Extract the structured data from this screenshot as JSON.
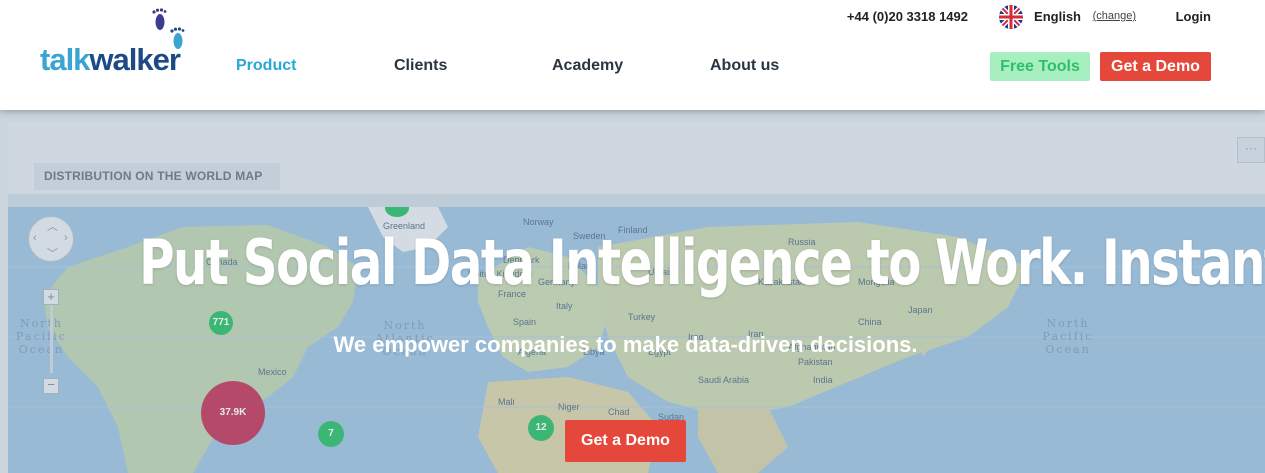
{
  "header": {
    "logo": {
      "part1": "talk",
      "part2": "walker",
      "alt": "talkwalker"
    },
    "phone": "+44 (0)20 3318 1492",
    "language": {
      "flag_icon": "uk-flag-icon",
      "current": "English",
      "change_label": "(change)"
    },
    "login_label": "Login",
    "nav": [
      {
        "label": "Product",
        "active": true
      },
      {
        "label": "Clients",
        "active": false
      },
      {
        "label": "Academy",
        "active": false
      },
      {
        "label": "About us",
        "active": false
      }
    ],
    "free_tools_label": "Free Tools",
    "get_demo_label": "Get a Demo"
  },
  "hero": {
    "headline": "Put Social Data Intelligence to Work. Instantly.",
    "subline": "We empower companies to make data-driven decisions.",
    "cta_label": "Get a Demo",
    "background": {
      "panel_title": "DISTRIBUTION ON THE WORLD MAP",
      "panel_menu": "···",
      "bubbles": [
        {
          "label": "771",
          "color": "#2fbf6a"
        },
        {
          "label": "37.9K",
          "color": "#c23a5b"
        },
        {
          "label": "7",
          "color": "#2fbf6a"
        },
        {
          "label": "12",
          "color": "#2fbf6a"
        },
        {
          "label": "",
          "color": "#2fbf6a"
        }
      ],
      "place_labels": [
        "Greenland",
        "Canada",
        "Norway",
        "Sweden",
        "Finland",
        "Denmark",
        "Poland",
        "Ukraine",
        "Kazakhstan",
        "Mongolia",
        "China",
        "Japan",
        "Iran",
        "Iraq",
        "Turkey",
        "Spain",
        "Algeria",
        "Libya",
        "Egypt",
        "Afghanistan",
        "Pakistan",
        "India",
        "Saudi Arabia",
        "Mexico",
        "United Kingdom",
        "France",
        "Germany",
        "Italy",
        "Mali",
        "Niger",
        "Chad",
        "Sudan",
        "Russia"
      ],
      "ocean_labels": [
        "North Pacific Ocean",
        "North Atlantic Ocean",
        "North Pacific Ocean"
      ]
    }
  },
  "colors": {
    "brand_blue": "#1d4a86",
    "brand_light_blue": "#2aa7d8",
    "demo_red": "#e5483b",
    "free_tools_green": "#a7efc1"
  }
}
